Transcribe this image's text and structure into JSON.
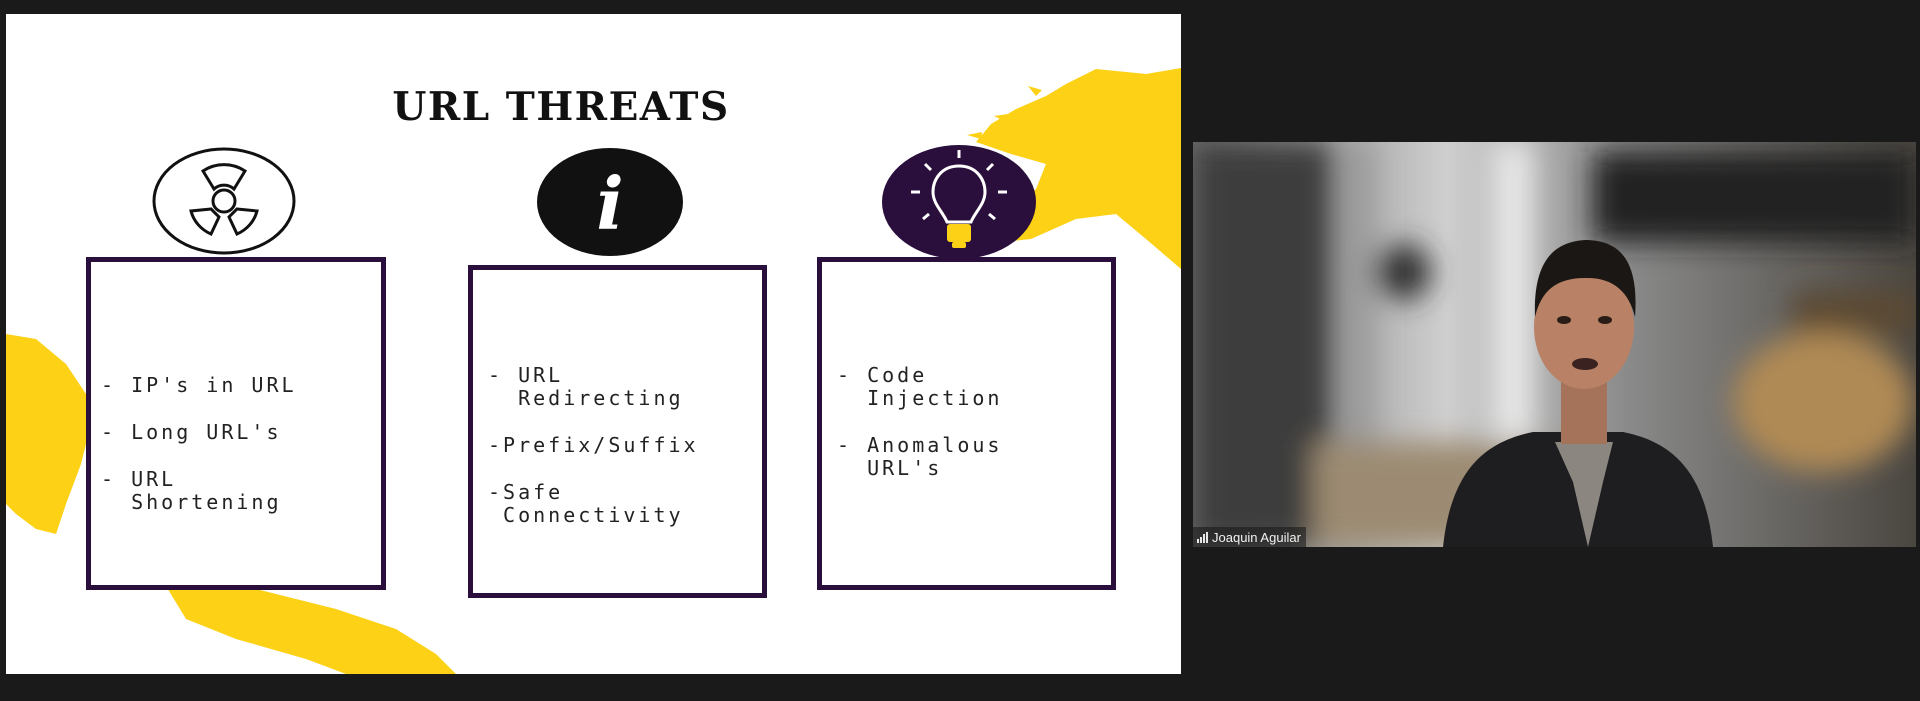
{
  "slide": {
    "title": "URL THREATS",
    "cards": [
      {
        "icon": "radiation-icon",
        "items": [
          {
            "dash": "- ",
            "text": "IP's in URL"
          },
          {
            "dash": "- ",
            "text": "Long URL's"
          },
          {
            "dash": "- ",
            "text": "URL Shortening"
          }
        ]
      },
      {
        "icon": "info-icon",
        "items": [
          {
            "dash": "- ",
            "text": "URL Redirecting"
          },
          {
            "dash": "-",
            "text": "Prefix/Suffix"
          },
          {
            "dash": "-",
            "text": "Safe Connectivity"
          }
        ]
      },
      {
        "icon": "lightbulb-icon",
        "items": [
          {
            "dash": "- ",
            "text": "Code Injection"
          },
          {
            "dash": "- ",
            "text": "Anomalous URL's"
          }
        ]
      }
    ]
  },
  "video": {
    "participant_name": "Joaquin Aguilar",
    "signal_icon": "signal-bars-icon"
  },
  "colors": {
    "app_background": "#1a1a1a",
    "slide_background": "#ffffff",
    "card_border": "#2a0e3b",
    "accent_yellow": "#fcd116",
    "bulb_circle": "#2a0e3b"
  }
}
